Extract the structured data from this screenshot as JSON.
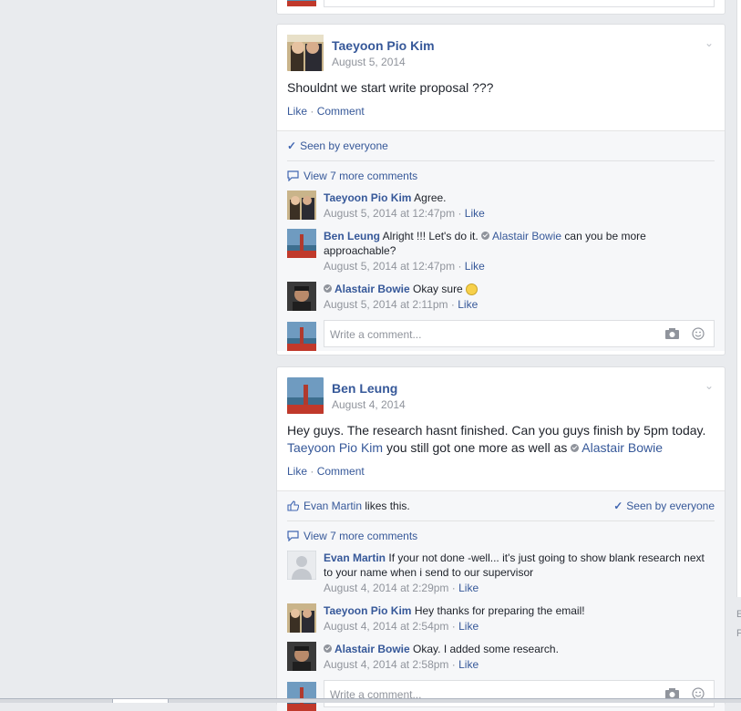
{
  "posts": [
    {
      "author": "Taeyoon Pio Kim",
      "date": "August 5, 2014",
      "body_text": "Shouldnt we start write proposal ???",
      "like_label": "Like",
      "comment_label": "Comment",
      "seen_label": "Seen by everyone",
      "view_more": "View 7 more comments",
      "comments": [
        {
          "name": "Taeyoon Pio Kim",
          "text": "Agree.",
          "time": "August 5, 2014 at 12:47pm",
          "like": "Like"
        },
        {
          "name": "Ben Leung",
          "text_before": "Alright !!! Let's do it.",
          "mention": "Alastair Bowie",
          "text_after": "can you be more approachable?",
          "time": "August 5, 2014 at 12:47pm",
          "like": "Like"
        },
        {
          "name": "Alastair Bowie",
          "text": "Okay sure",
          "time": "August 5, 2014 at 2:11pm",
          "like": "Like"
        }
      ],
      "write_placeholder": "Write a comment..."
    },
    {
      "author": "Ben Leung",
      "date": "August 4, 2014",
      "body_text_1": "Hey guys. The research hasnt finished. Can you guys finish by 5pm today.",
      "body_mention_1": "Taeyoon Pio Kim",
      "body_text_2": "you still got one more as well as",
      "body_mention_2": "Alastair Bowie",
      "like_label": "Like",
      "comment_label": "Comment",
      "likes_name": "Evan Martin",
      "likes_suffix": "likes this.",
      "seen_label": "Seen by everyone",
      "view_more": "View 7 more comments",
      "comments": [
        {
          "name": "Evan Martin",
          "text": "If your not done -well... it's just going to show blank research next to your name when i send to our supervisor",
          "time": "August 4, 2014 at 2:29pm",
          "like": "Like"
        },
        {
          "name": "Taeyoon Pio Kim",
          "text": "Hey thanks for preparing the email!",
          "time": "August 4, 2014 at 2:54pm",
          "like": "Like"
        },
        {
          "name": "Alastair Bowie",
          "text": "Okay. I added some research.",
          "time": "August 4, 2014 at 2:58pm",
          "like": "Like"
        }
      ],
      "write_placeholder": "Write a comment..."
    }
  ],
  "sep": "·",
  "right_letters": [
    "E",
    "F"
  ]
}
